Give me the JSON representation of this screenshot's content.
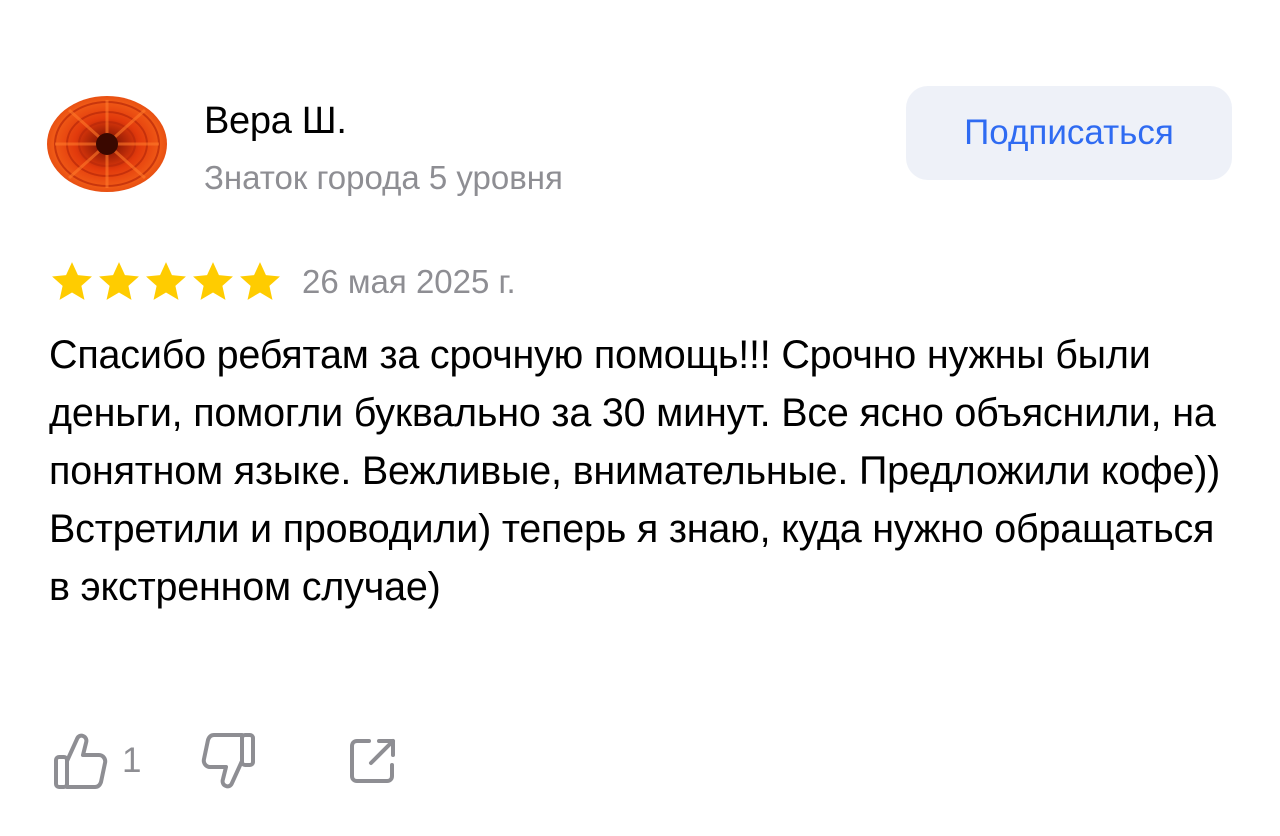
{
  "user": {
    "name": "Вера Ш.",
    "level": "Знаток города 5 уровня",
    "avatar_icon": "orange-flower-avatar"
  },
  "subscribe": {
    "label": "Подписаться"
  },
  "review": {
    "rating": 5,
    "rating_max": 5,
    "date": "26 мая 2025 г.",
    "text": "Спасибо ребятам за срочную помощь!!! Срочно нужны были деньги, помогли буквально за 30 минут. Все ясно объяснили, на понятном языке. Вежливые, внимательные. Предложили кофе)) Встретили и проводили) теперь я знаю, куда нужно обращаться в экстренном случае)"
  },
  "actions": {
    "likes": "1",
    "like_icon": "thumbs-up-icon",
    "dislike_icon": "thumbs-down-icon",
    "share_icon": "share-icon"
  },
  "colors": {
    "accent": "#2f6bf2",
    "star": "#ffcc00",
    "muted": "#8e8e93",
    "button_bg": "#eef1f8"
  }
}
